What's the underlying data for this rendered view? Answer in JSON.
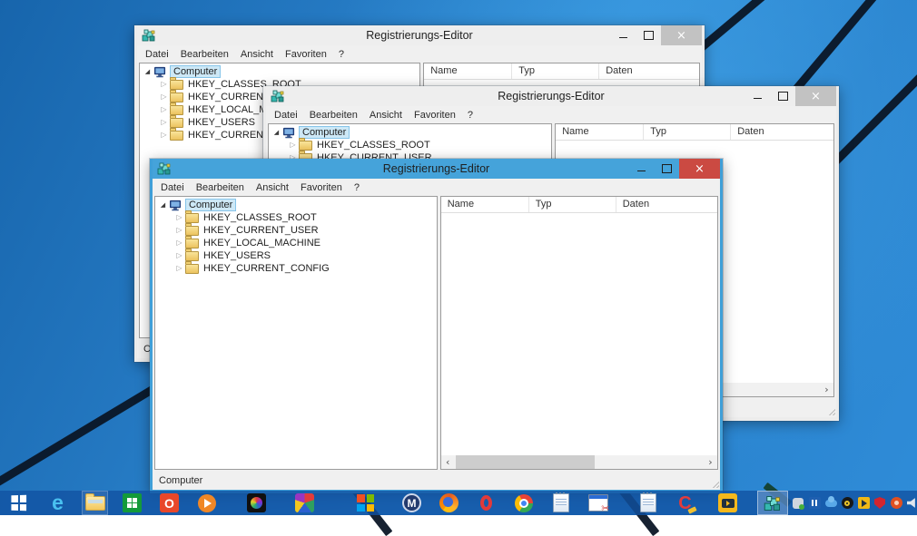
{
  "desktop": {
    "os_name": "Windows 8.1 Desktop"
  },
  "window": {
    "title": "Registrierungs-Editor",
    "menu": [
      "Datei",
      "Bearbeiten",
      "Ansicht",
      "Favoriten",
      "?"
    ],
    "tree_root": "Computer",
    "tree_items": [
      "HKEY_CLASSES_ROOT",
      "HKEY_CURRENT_USER",
      "HKEY_LOCAL_MACHINE",
      "HKEY_USERS",
      "HKEY_CURRENT_CONFIG"
    ],
    "columns": [
      "Name",
      "Typ",
      "Daten"
    ],
    "status": "Computer"
  },
  "icons": {
    "expander_expanded": "◢",
    "expander_collapsed": "▷",
    "scroll_left": "‹",
    "scroll_right": "›",
    "close_glyph": "×"
  },
  "windows": [
    {
      "id": "back",
      "title": "Registrierungs-Editor",
      "active": false
    },
    {
      "id": "middle",
      "title": "Registrierungs-Editor",
      "active": false
    },
    {
      "id": "front",
      "title": "Registrierungs-Editor",
      "active": true
    }
  ],
  "taskbar": {
    "icons": [
      "start",
      "internet-explorer",
      "file-explorer",
      "windows-store",
      "office",
      "media-player",
      "photo-app",
      "pinwheel-app",
      "ms-colors",
      "maxthon",
      "firefox",
      "opera",
      "chrome",
      "notepad",
      "snipping-tool",
      "text-editor",
      "ccleaner",
      "video-app",
      "regedit"
    ],
    "tray_icons": [
      "usb-eject",
      "pause-app",
      "cloud-sync",
      "camera-app",
      "play-app",
      "security-shield",
      "download-manager",
      "volume",
      "brush-tool"
    ]
  },
  "colors": {
    "active_titlebar": "#45a3da",
    "inactive_titlebar": "#eeeeee",
    "active_border": "#3f9fd8",
    "close_button_active": "#cb4a42",
    "close_button_inactive": "#c2c2c2",
    "selection_fill": "#cde8f6",
    "selection_border": "#86c4e9",
    "desktop_blue": "#2a84cf",
    "wallpaper_stripe": "#0b1626",
    "taskbar_blue": "rgba(17,82,162,0.8)",
    "folder_yellow": "#ecc35f"
  }
}
